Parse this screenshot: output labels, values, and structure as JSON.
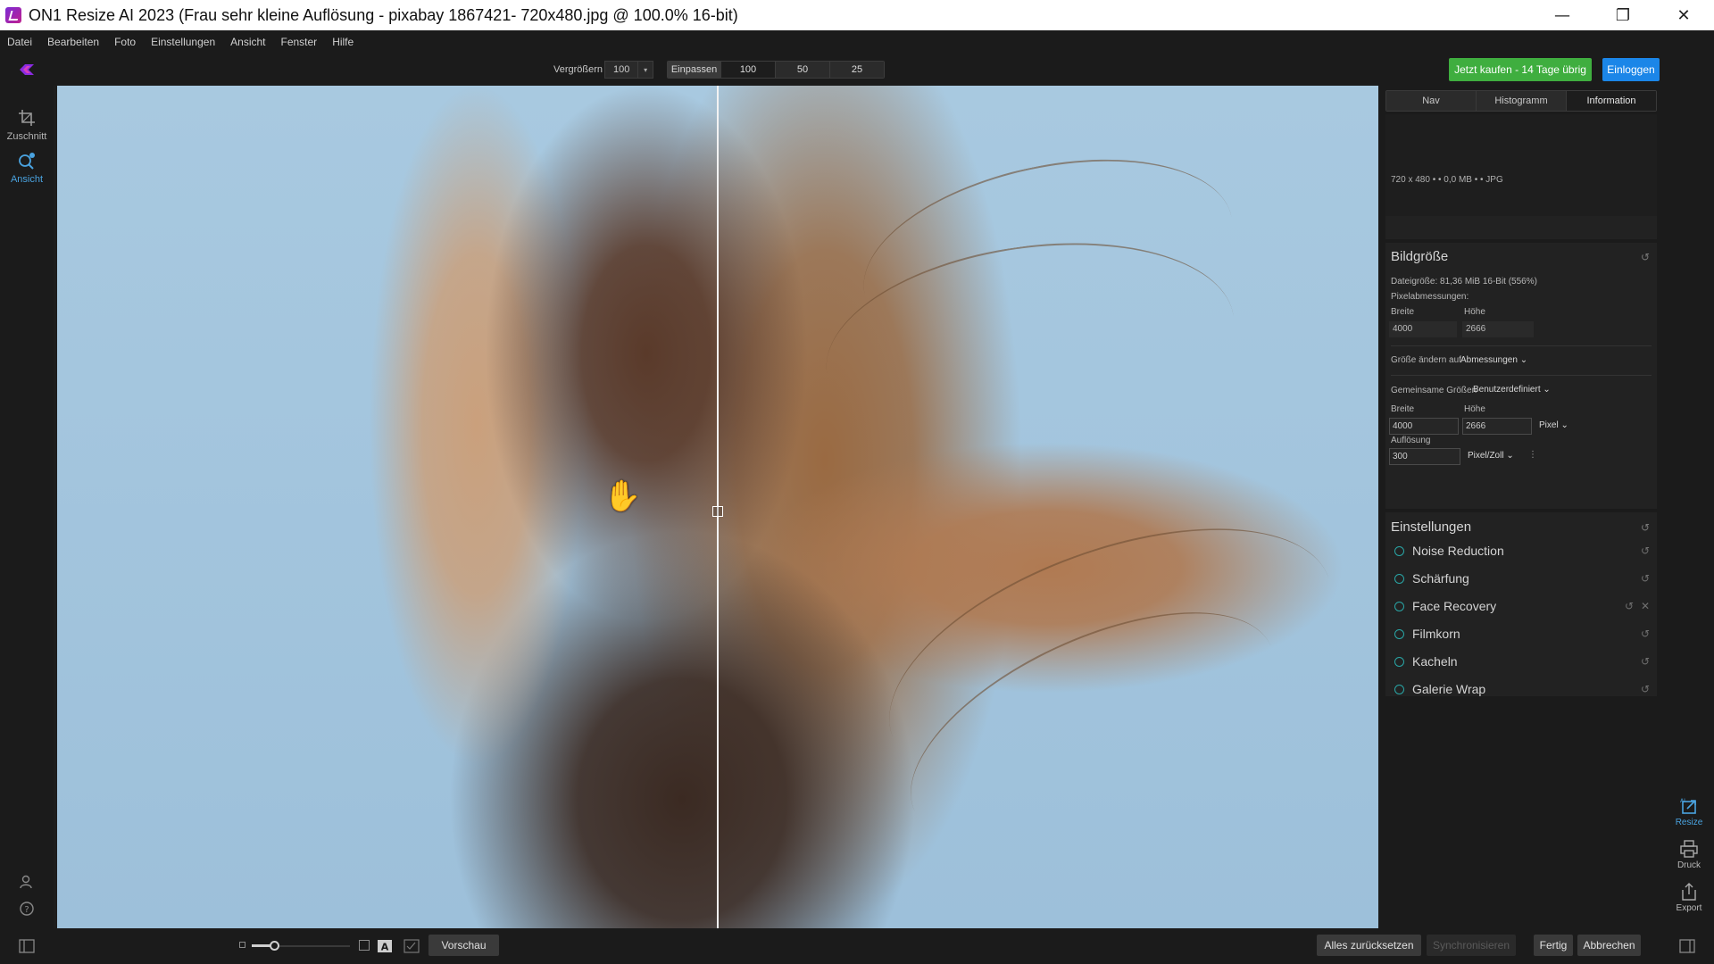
{
  "window": {
    "title": "ON1 Resize AI 2023 (Frau sehr kleine Auflösung - pixabay 1867421- 720x480.jpg @ 100.0% 16-bit)",
    "controls": [
      "—",
      "❐",
      "✕"
    ]
  },
  "menu": [
    "Datei",
    "Bearbeiten",
    "Foto",
    "Einstellungen",
    "Ansicht",
    "Fenster",
    "Hilfe"
  ],
  "toolbar": {
    "zoom_label": "Vergrößern",
    "zoom_value": "100",
    "fit_label": "Einpassen",
    "zoom_presets": [
      "100",
      "50",
      "25"
    ],
    "buy_label": "Jetzt kaufen - 14 Tage übrig",
    "login_label": "Einloggen",
    "accent_green": "#3fae3f",
    "accent_blue": "#1b86e8"
  },
  "left_tools": [
    {
      "label": "Zuschnitt",
      "icon": "crop-icon"
    },
    {
      "label": "Ansicht",
      "icon": "view-zoom-icon"
    }
  ],
  "right_panel": {
    "tabs": [
      "Nav",
      "Histogramm",
      "Information"
    ],
    "active_tab": "Information",
    "info_line": "720 x 480 • • 0,0 MB • • JPG",
    "image_size": {
      "title": "Bildgröße",
      "file_size": "Dateigröße: 81,36 MiB 16-Bit (556%)",
      "pixel_dims_label": "Pixelabmessungen:",
      "width_label": "Breite",
      "height_label": "Höhe",
      "width_value": "4000",
      "height_value": "2666",
      "resize_to_label": "Größe ändern auf",
      "resize_to_value": "Abmessungen",
      "common_sizes_label": "Gemeinsame Größen",
      "common_sizes_value": "Benutzerdefiniert",
      "width_input": "4000",
      "height_input": "2666",
      "unit": "Pixel",
      "resolution_label": "Auflösung",
      "resolution_value": "300",
      "resolution_unit": "Pixel/Zoll"
    },
    "settings": {
      "title": "Einstellungen",
      "items": [
        "Noise Reduction",
        "Schärfung",
        "Face Recovery",
        "Filmkorn",
        "Kacheln",
        "Galerie Wrap"
      ],
      "accent": "#29a6a6"
    }
  },
  "far_right_tools": [
    {
      "label": "Resize",
      "icon": "resize-ai-icon"
    },
    {
      "label": "Druck",
      "icon": "print-icon"
    },
    {
      "label": "Export",
      "icon": "export-icon"
    }
  ],
  "bottom": {
    "preview_label": "Vorschau",
    "reset_all_label": "Alles zurücksetzen",
    "sync_label": "Synchronisieren",
    "done_label": "Fertig",
    "cancel_label": "Abbrechen"
  }
}
